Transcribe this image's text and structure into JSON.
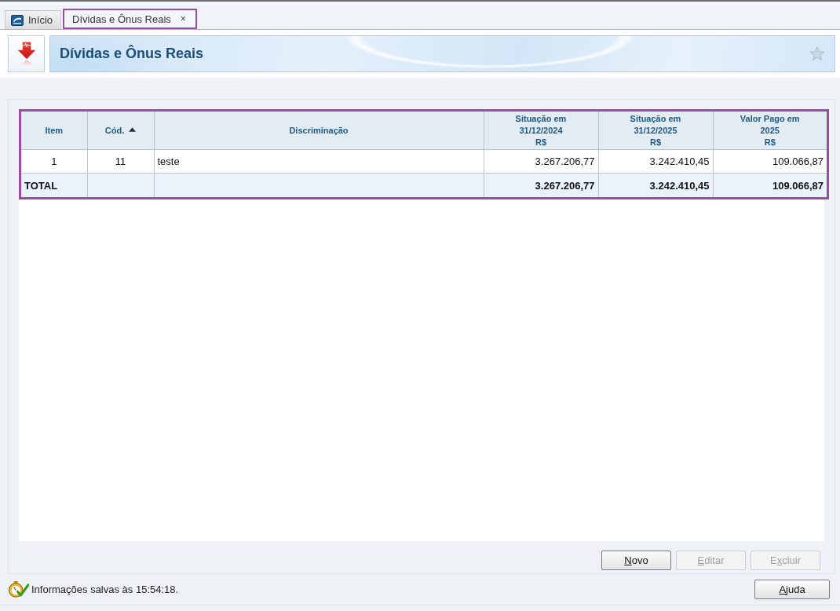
{
  "tabs": [
    {
      "label": "Início",
      "kind": "home",
      "selected": false,
      "highlighted": false
    },
    {
      "label": "Dívidas e Ônus Reais",
      "kind": "page",
      "selected": true,
      "highlighted": true,
      "close": "×"
    }
  ],
  "header": {
    "title": "Dívidas e Ônus Reais",
    "favorite": false
  },
  "table": {
    "highlighted": true,
    "columns": [
      {
        "label_lines": [
          "Item"
        ],
        "kind": "center",
        "sorted": false
      },
      {
        "label_lines": [
          "Cód."
        ],
        "kind": "center",
        "sorted": true
      },
      {
        "label_lines": [
          "Discriminação"
        ],
        "kind": "text",
        "sorted": false
      },
      {
        "label_lines": [
          "Situação em",
          "31/12/2024",
          "R$"
        ],
        "kind": "money",
        "sorted": false
      },
      {
        "label_lines": [
          "Situação em",
          "31/12/2025",
          "R$"
        ],
        "kind": "money",
        "sorted": false
      },
      {
        "label_lines": [
          "Valor Pago em",
          "2025",
          "R$"
        ],
        "kind": "money",
        "sorted": false
      }
    ],
    "rows": [
      {
        "cells": [
          "1",
          "11",
          "teste",
          "3.267.206,77",
          "3.242.410,45",
          "109.066,87"
        ]
      }
    ],
    "total": {
      "label": "TOTAL",
      "amounts": [
        "3.267.206,77",
        "3.242.410,45",
        "109.066,87"
      ]
    }
  },
  "buttons": [
    {
      "mnemonic": "N",
      "after": "ovo",
      "disabled": false
    },
    {
      "mnemonic": "E",
      "after": "ditar",
      "disabled": true
    },
    {
      "before": "E",
      "mnemonic": "x",
      "after": "cluir",
      "disabled": true
    }
  ],
  "status_bar": {
    "message": "Informações salvas às 15:54:18.",
    "help_button": {
      "mnemonic": "A",
      "after": "juda",
      "disabled": false
    }
  }
}
